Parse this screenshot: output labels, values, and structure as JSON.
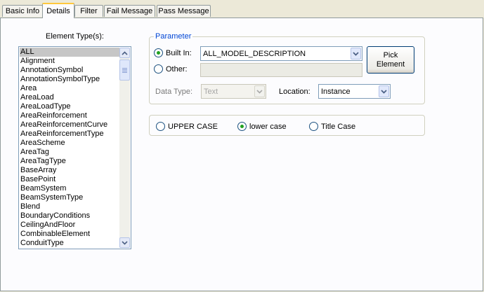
{
  "tabs": [
    {
      "label": "Basic Info"
    },
    {
      "label": "Details"
    },
    {
      "label": "Filter"
    },
    {
      "label": "Fail Message"
    },
    {
      "label": "Pass Message"
    }
  ],
  "active_tab": "Details",
  "element_types": {
    "label": "Element Type(s):",
    "selected": "ALL",
    "items": [
      "ALL",
      "Alignment",
      "AnnotationSymbol",
      "AnnotationSymbolType",
      "Area",
      "AreaLoad",
      "AreaLoadType",
      "AreaReinforcement",
      "AreaReinforcementCurve",
      "AreaReinforcementType",
      "AreaScheme",
      "AreaTag",
      "AreaTagType",
      "BaseArray",
      "BasePoint",
      "BeamSystem",
      "BeamSystemType",
      "Blend",
      "BoundaryConditions",
      "CeilingAndFloor",
      "CombinableElement",
      "ConduitType"
    ]
  },
  "parameter": {
    "legend": "Parameter",
    "built_in_label": "Built In:",
    "built_in_value": "ALL_MODEL_DESCRIPTION",
    "built_in_checked": true,
    "other_label": "Other:",
    "other_value": "",
    "other_checked": false,
    "pick_button": "Pick\nElement",
    "data_type_label": "Data Type:",
    "data_type_value": "Text",
    "location_label": "Location:",
    "location_value": "Instance"
  },
  "case_options": {
    "options": [
      "UPPER CASE",
      "lower case",
      "Title Case"
    ],
    "selected": "lower case"
  },
  "colors": {
    "accent_legend": "#0046d5",
    "radio_dot": "#21a121",
    "tab_highlight": "#ffc83c"
  }
}
